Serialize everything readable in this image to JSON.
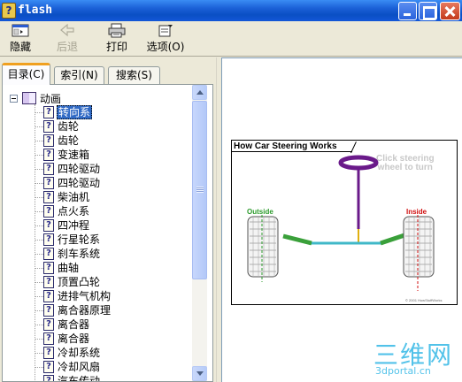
{
  "window": {
    "title": "flash"
  },
  "toolbar": {
    "hide_label": "隐藏",
    "back_label": "后退",
    "print_label": "打印",
    "options_label": "选项(O)"
  },
  "tabs": [
    {
      "label": "目录(C)",
      "active": true
    },
    {
      "label": "索引(N)",
      "active": false
    },
    {
      "label": "搜索(S)",
      "active": false
    }
  ],
  "tree": {
    "root_label": "动画",
    "items": [
      {
        "label": "转向系",
        "selected": true
      },
      {
        "label": "齿轮"
      },
      {
        "label": "齿轮"
      },
      {
        "label": "变速箱"
      },
      {
        "label": "四轮驱动"
      },
      {
        "label": "四轮驱动"
      },
      {
        "label": "柴油机"
      },
      {
        "label": "点火系"
      },
      {
        "label": "四冲程"
      },
      {
        "label": "行星轮系"
      },
      {
        "label": "刹车系统"
      },
      {
        "label": "曲轴"
      },
      {
        "label": "顶置凸轮"
      },
      {
        "label": "进排气机构"
      },
      {
        "label": "离合器原理"
      },
      {
        "label": "离合器"
      },
      {
        "label": "离合器"
      },
      {
        "label": "冷却系统"
      },
      {
        "label": "冷却风扇"
      },
      {
        "label": "汽车传动"
      }
    ]
  },
  "flash": {
    "title": "How Car Steering Works",
    "hint_line1": "Click steering",
    "hint_line2": "wheel to turn",
    "outside_label": "Outside",
    "inside_label": "Inside",
    "copyright": "© 2001 HowStuffWorks",
    "colors": {
      "outside": "#2a9a2a",
      "inside": "#d01010",
      "wheel": "#6a1a8a",
      "rack": "#40b8c8"
    }
  },
  "watermark": {
    "main": "三维网",
    "sub": "3dportal.cn"
  }
}
